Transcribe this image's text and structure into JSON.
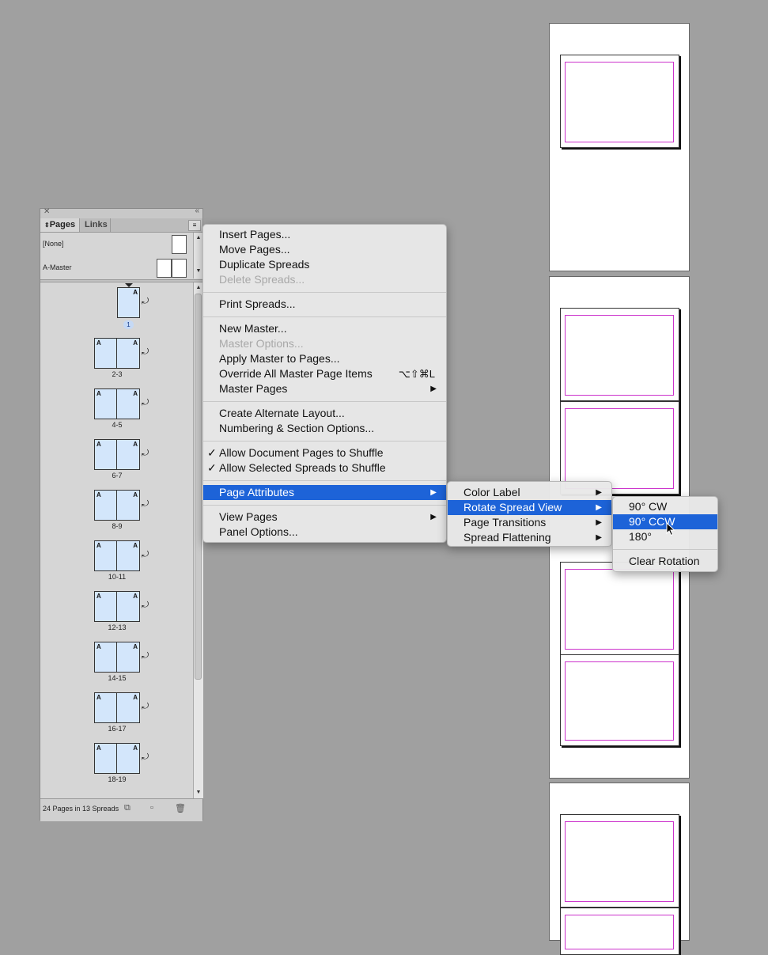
{
  "panel": {
    "tabs": [
      "Pages",
      "Links"
    ],
    "masters": [
      {
        "label": "[None]"
      },
      {
        "label": "A-Master"
      }
    ],
    "master_prefix": "A",
    "spreads": [
      "2-3",
      "4-5",
      "6-7",
      "8-9",
      "10-11",
      "12-13",
      "14-15",
      "16-17",
      "18-19"
    ],
    "page1_label": "1",
    "footer_count": "24 Pages in 13 Spreads"
  },
  "main_menu": {
    "items": [
      {
        "label": "Insert Pages..."
      },
      {
        "label": "Move Pages..."
      },
      {
        "label": "Duplicate Spreads"
      },
      {
        "label": "Delete Spreads...",
        "disabled": true
      },
      {
        "label": "Print Spreads..."
      },
      {
        "label": "New Master..."
      },
      {
        "label": "Master Options...",
        "disabled": true
      },
      {
        "label": "Apply Master to Pages..."
      },
      {
        "label": "Override All Master Page Items",
        "shortcut": "⌥⇧⌘L"
      },
      {
        "label": "Master Pages",
        "submenu": true
      },
      {
        "label": "Create Alternate Layout..."
      },
      {
        "label": "Numbering & Section Options..."
      },
      {
        "label": "Allow Document Pages to Shuffle",
        "checked": true
      },
      {
        "label": "Allow Selected Spreads to Shuffle",
        "checked": true
      },
      {
        "label": "Page Attributes",
        "submenu": true,
        "highlighted": true
      },
      {
        "label": "View Pages",
        "submenu": true
      },
      {
        "label": "Panel Options..."
      }
    ]
  },
  "page_attributes_menu": {
    "items": [
      {
        "label": "Color Label",
        "submenu": true
      },
      {
        "label": "Rotate Spread View",
        "submenu": true,
        "highlighted": true
      },
      {
        "label": "Page Transitions",
        "submenu": true
      },
      {
        "label": "Spread Flattening",
        "submenu": true
      }
    ]
  },
  "rotate_menu": {
    "items": [
      {
        "label": "90° CW"
      },
      {
        "label": "90° CCW",
        "highlighted": true
      },
      {
        "label": "180°"
      },
      {
        "label": "Clear Rotation"
      }
    ]
  },
  "colors": {
    "highlight": "#1d63d8",
    "page_thumb": "#d3e6fb",
    "margin_guide": "#cc33cc"
  }
}
